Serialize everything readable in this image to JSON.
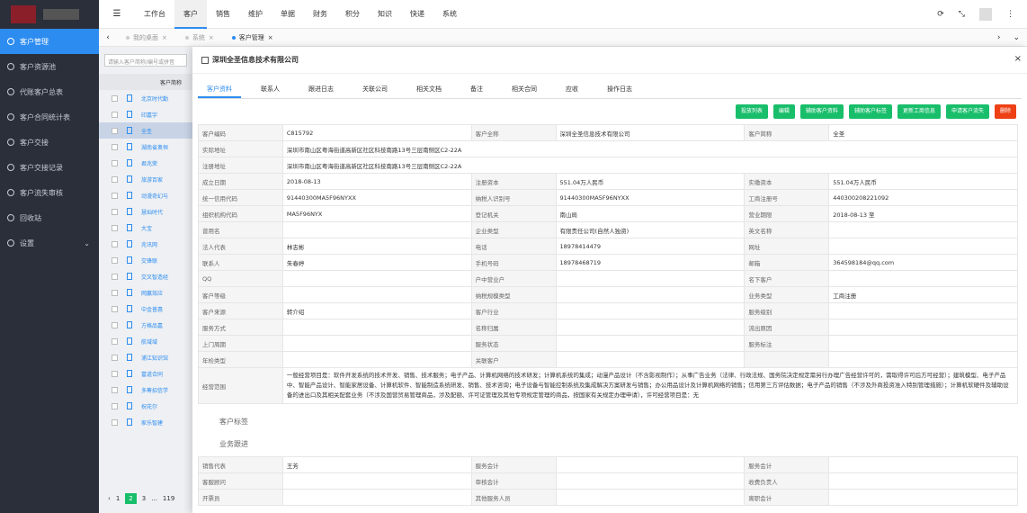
{
  "sidebar": {
    "items": [
      {
        "label": "客户管理",
        "active": true
      },
      {
        "label": "客户资源池"
      },
      {
        "label": "代账客户总表"
      },
      {
        "label": "客户合同统计表"
      },
      {
        "label": "客户交接"
      },
      {
        "label": "客户交接记录"
      },
      {
        "label": "客户流失审核"
      },
      {
        "label": "回收站"
      },
      {
        "label": "设置",
        "chev": "⌄"
      }
    ]
  },
  "topbar": {
    "menu_icon": "☰",
    "nav": [
      "工作台",
      "客户",
      "销售",
      "维护",
      "单据",
      "财务",
      "积分",
      "知识",
      "快递",
      "系统"
    ],
    "active_nav": 1,
    "refresh_icon": "⟳",
    "expand_icon": "⤡",
    "more_icon": "⋮"
  },
  "tabs": {
    "items": [
      "我的桌面",
      "系统",
      "客户管理"
    ],
    "active": 2,
    "close": "×",
    "left_arrow": "‹",
    "right_arrow": "›",
    "down_arrow": "⌄"
  },
  "list": {
    "search_placeholder": "请输入客户简称/编号或拼音",
    "col_header": "客户简称",
    "rows": [
      "北京时代勤",
      "印嘉宇",
      "全圣",
      "湖南省奥恒",
      "君兆荣",
      "旅游百家",
      "动漫奇幻与",
      "慧灿时代",
      "大宝",
      "兆讯网",
      "交锋联",
      "交叉智造经",
      "网赢效应",
      "中金普惠",
      "方格品嘉",
      "航域域",
      "浦江知识馆",
      "富道合同",
      "多筹招信学",
      "祝花尔",
      "家乐智建"
    ],
    "selected": 2,
    "pages": [
      "‹",
      "1",
      "2",
      "3",
      "...",
      "119"
    ],
    "current_page": 1
  },
  "modal": {
    "title": "深圳全圣信息技术有限公司",
    "close": "×",
    "tabs": [
      "客户资料",
      "联系人",
      "跟进日志",
      "关联公司",
      "相关文档",
      "备注",
      "相关合同",
      "应收",
      "操作日志"
    ],
    "active_tab": 0,
    "buttons": [
      {
        "label": "投放列表"
      },
      {
        "label": "编辑"
      },
      {
        "label": "辅助客户资料"
      },
      {
        "label": "辅助客户标签"
      },
      {
        "label": "更新工商信息"
      },
      {
        "label": "申请客户流失"
      },
      {
        "label": "删除",
        "red": true
      }
    ],
    "rows": [
      [
        "客户编码",
        "C815792",
        "客户全称",
        "深圳全圣信息技术有限公司",
        "客户简称",
        "全圣"
      ],
      [
        "实际地址",
        "深圳市南山区粤海街道高新区社区科技南路13号三层南侧区C2-22A"
      ],
      [
        "注册地址",
        "深圳市南山区粤海街道高新区社区科技南路13号三层南侧区C2-22A"
      ],
      [
        "成立日期",
        "2018-08-13",
        "注册资本",
        "551.04万人民币",
        "实缴资本",
        "551.04万人民币"
      ],
      [
        "统一信用代码",
        "91440300MA5F96NYXX",
        "纳税人识别号",
        "91440300MA5F96NYXX",
        "工商注册号",
        "440300208221092"
      ],
      [
        "组织机构代码",
        "MA5F96NYX",
        "登记机关",
        "南山局",
        "营业期限",
        "2018-08-13 至"
      ],
      [
        "曾用名",
        "",
        "企业类型",
        "有限责任公司(自然人独资)",
        "英文名称",
        ""
      ],
      [
        "法人代表",
        "林志彬",
        "电话",
        "18978414479",
        "网址",
        ""
      ],
      [
        "联系人",
        "朱春婷",
        "手机号码",
        "18978468719",
        "邮箱",
        "364598184@qq.com"
      ],
      [
        "QQ",
        "",
        "户中营业户",
        "",
        "名下客户",
        ""
      ],
      [
        "客户等级",
        "",
        "纳税规模类型",
        "",
        "业务类型",
        "工商注册"
      ],
      [
        "客户来源",
        "转介绍",
        "客户行业",
        "",
        "服务级别",
        ""
      ],
      [
        "服务方式",
        "",
        "名称归属",
        "",
        "流出原因",
        ""
      ],
      [
        "上门周期",
        "",
        "服务状态",
        "",
        "服务标注",
        ""
      ],
      [
        "年检类型",
        "",
        "关联客户",
        ""
      ],
      [
        "经营范围",
        "一般经营项目是：软件开发系统的技术开发、销售、技术服务；电子产品、计算机网络的技术研发；计算机系统的集成；动漫产品设计（不含影视制作）；从事广告业务（法律、行政法规、国务院决定规定需另行办理广告经营许可的，需取得许可后方可经营）；建筑模型、电子产品中、智能产品设计、智能家居设备、计算机软件、智能制造系统研发、销售、技术咨询；电子设备与智能控制系统及集成解决方案研发与销售；办公用品设计及计算机网络的销售；信用第三方评估数据；电子产品的销售（不涉及外商投资准入特别管理措施）；计算机软硬件及辅助设备的进出口及其相关配套业务（不涉及国营贸易管理商品，涉及配额、许可证管理及其他专项规定管理的商品，按国家有关规定办理申请），许可经营项目是：无"
      ]
    ],
    "sec_tag": "客户标签",
    "sec_follow": "业务跟进",
    "follow_rows": [
      [
        "销售代表",
        "王芳",
        "服务会计",
        "",
        "服务会计",
        ""
      ],
      [
        "客服顾问",
        "",
        "审核会计",
        "",
        "收费负责人",
        ""
      ],
      [
        "开票员",
        "",
        "其他服务人员",
        "",
        "离职会计",
        ""
      ]
    ]
  }
}
